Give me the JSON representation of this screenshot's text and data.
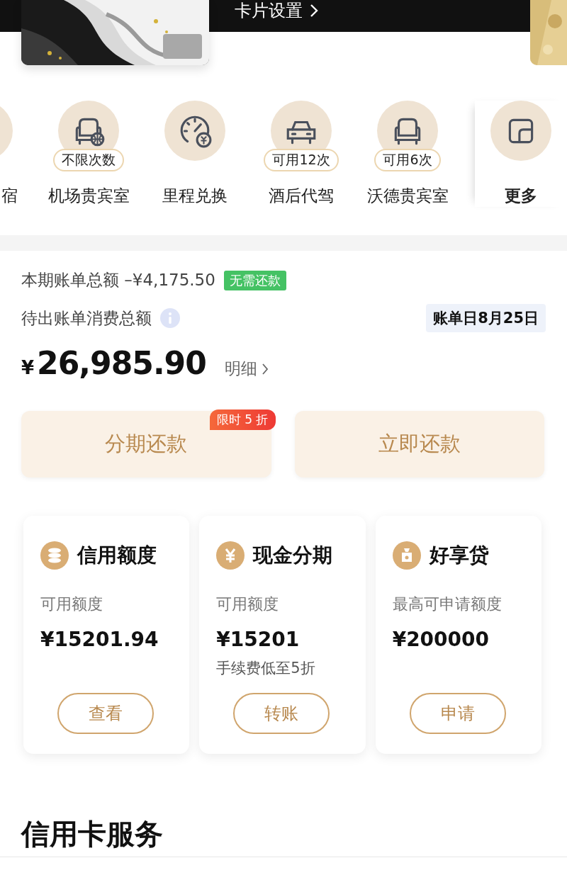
{
  "header": {
    "settings_link": "卡片设置"
  },
  "services": [
    {
      "label": "宿"
    },
    {
      "label": "机场贵宾室",
      "kind": "lounge",
      "badge": "不限次数"
    },
    {
      "label": "里程兑换",
      "kind": "gauge"
    },
    {
      "label": "酒后代驾",
      "kind": "car",
      "badge": "可用12次"
    },
    {
      "label": "沃德贵宾室",
      "kind": "sofa",
      "badge": "可用6次"
    }
  ],
  "more": {
    "label": "更多"
  },
  "bill": {
    "statement_label": "本期账单总额 –¥4,175.50",
    "status_tag": "无需还款",
    "pending_label": "待出账单消费总额",
    "due_tag": "账单日8月25日",
    "currency": "¥",
    "amount": "26,985.90",
    "detail_link": "明细"
  },
  "actions": [
    {
      "label": "分期还款",
      "promo": "限时 5 折"
    },
    {
      "label": "立即还款"
    }
  ],
  "products": [
    {
      "title": "信用额度",
      "kind": "coins",
      "label": "可用额度",
      "amount": "¥15201.94",
      "button": "查看"
    },
    {
      "title": "现金分期",
      "kind": "yen",
      "label": "可用额度",
      "amount": "¥15201",
      "note": "手续费低至5折",
      "button": "转账"
    },
    {
      "title": "好享贷",
      "kind": "bag",
      "label": "最高可申请额度",
      "amount": "¥200000",
      "button": "申请"
    }
  ],
  "section_title": "信用卡服务"
}
